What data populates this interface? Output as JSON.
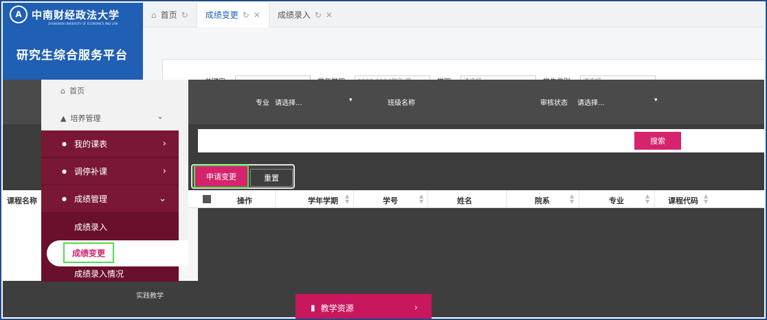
{
  "brand": {
    "school_name": "中南财经政法大学",
    "school_name_en": "ZHONGNAN UNIVERSITY OF ECONOMICS AND LAW",
    "platform_title": "研究生综合服务平台"
  },
  "tabs": [
    {
      "label": "首页"
    },
    {
      "label": "成绩变更"
    },
    {
      "label": "成绩录入"
    }
  ],
  "search": {
    "keyword_label": "关键字",
    "term_label": "学年学期",
    "term_value": "2023-2024学年 第...",
    "lesson_label": "学期",
    "lesson_value": "请选择...",
    "student_type_label": "学生类别",
    "student_type_value": "请选择...",
    "major_label": "专业",
    "major_value": "请选择...",
    "class_label": "班级名称",
    "status_label": "审核状态",
    "status_value": "请选择...",
    "query_button": "搜索"
  },
  "toolbar": {
    "apply_button": "申请变更",
    "reset_button": "重置"
  },
  "table": {
    "left_header": "课程名称",
    "headers": [
      "操作",
      "学年学期",
      "学号",
      "姓名",
      "院系",
      "专业",
      "课程代码"
    ]
  },
  "sidebar": {
    "home_label": "首页",
    "training_label": "培养管理",
    "items": [
      {
        "label": "我的课表"
      },
      {
        "label": "调停补课"
      },
      {
        "label": "成绩管理"
      }
    ],
    "sub_items": [
      {
        "label": "成绩录入"
      },
      {
        "label": "成绩变更"
      },
      {
        "label": "成绩录入情况"
      }
    ],
    "bottom_label": "实践教学",
    "teaching_resources": "教学资源"
  },
  "colors": {
    "brand_blue": "#1f5fb4",
    "accent_pink": "#d6236e",
    "menu_maroon": "#7a1734",
    "highlight_green": "#4be04b"
  }
}
